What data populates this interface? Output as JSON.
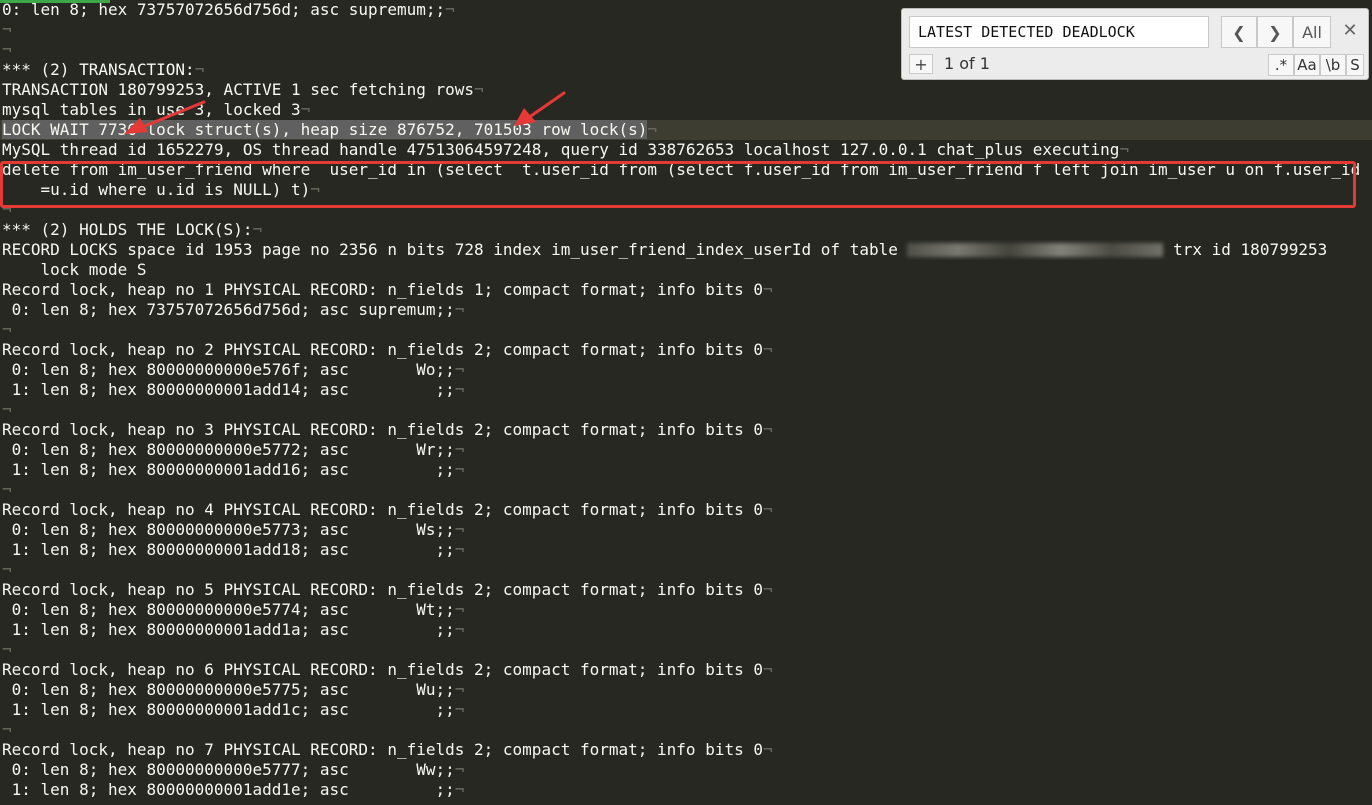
{
  "find": {
    "query": "LATEST DETECTED DEADLOCK",
    "prev_icon": "❮",
    "next_icon": "❯",
    "all_label": "All",
    "close_icon": "✕",
    "plus_label": "+",
    "match_count": "1 of 1",
    "regex_label": ".*",
    "case_label": "Aa",
    "word_label": "\\b",
    "selection_label": "S"
  },
  "eol_mark": "¬",
  "lines": {
    "l0": "0: len 8; hex 73757072656d756d; asc supremum;;",
    "l1": "",
    "l2": "",
    "l3": "*** (2) TRANSACTION:",
    "l4": "TRANSACTION 180799253, ACTIVE 1 sec fetching rows",
    "l5": "mysql tables in use 3, locked 3",
    "l6": "LOCK WAIT 7736 lock struct(s), heap size 876752, 701503 row lock(s)",
    "l7": "MySQL thread id 1652279, OS thread handle 47513064597248, query id 338762653 localhost 127.0.0.1 chat_plus executing",
    "l8": "delete from im_user_friend where  user_id in (select  t.user_id from (select f.user_id from im_user_friend f left join im_user u on f.user_id",
    "l9": "    =u.id where u.id is NULL) t)",
    "l10": "",
    "l11": "*** (2) HOLDS THE LOCK(S):",
    "l12a": "RECORD LOCKS space id 1953 page no 2356 n bits 728 index im_user_friend_index_userId of table ",
    "l12b": " trx id 180799253",
    "l13": "    lock mode S",
    "l14": "Record lock, heap no 1 PHYSICAL RECORD: n_fields 1; compact format; info bits 0",
    "l15": " 0: len 8; hex 73757072656d756d; asc supremum;;",
    "l16": "",
    "l17": "Record lock, heap no 2 PHYSICAL RECORD: n_fields 2; compact format; info bits 0",
    "l18": " 0: len 8; hex 80000000000e576f; asc       Wo;;",
    "l19": " 1: len 8; hex 80000000001add14; asc         ;;",
    "l20": "",
    "l21": "Record lock, heap no 3 PHYSICAL RECORD: n_fields 2; compact format; info bits 0",
    "l22": " 0: len 8; hex 80000000000e5772; asc       Wr;;",
    "l23": " 1: len 8; hex 80000000001add16; asc         ;;",
    "l24": "",
    "l25": "Record lock, heap no 4 PHYSICAL RECORD: n_fields 2; compact format; info bits 0",
    "l26": " 0: len 8; hex 80000000000e5773; asc       Ws;;",
    "l27": " 1: len 8; hex 80000000001add18; asc         ;;",
    "l28": "",
    "l29": "Record lock, heap no 5 PHYSICAL RECORD: n_fields 2; compact format; info bits 0",
    "l30": " 0: len 8; hex 80000000000e5774; asc       Wt;;",
    "l31": " 1: len 8; hex 80000000001add1a; asc         ;;",
    "l32": "",
    "l33": "Record lock, heap no 6 PHYSICAL RECORD: n_fields 2; compact format; info bits 0",
    "l34": " 0: len 8; hex 80000000000e5775; asc       Wu;;",
    "l35": " 1: len 8; hex 80000000001add1c; asc         ;;",
    "l36": "",
    "l37": "Record lock, heap no 7 PHYSICAL RECORD: n_fields 2; compact format; info bits 0",
    "l38": " 0: len 8; hex 80000000000e5777; asc       Ww;;",
    "l39": " 1: len 8; hex 80000000001add1e; asc         ;;"
  },
  "colors": {
    "editor_bg": "#272822",
    "text": "#f8f8f2",
    "selection": "#606060",
    "highlight_box": "#e53935",
    "tab_accent": "#3fa64a"
  }
}
